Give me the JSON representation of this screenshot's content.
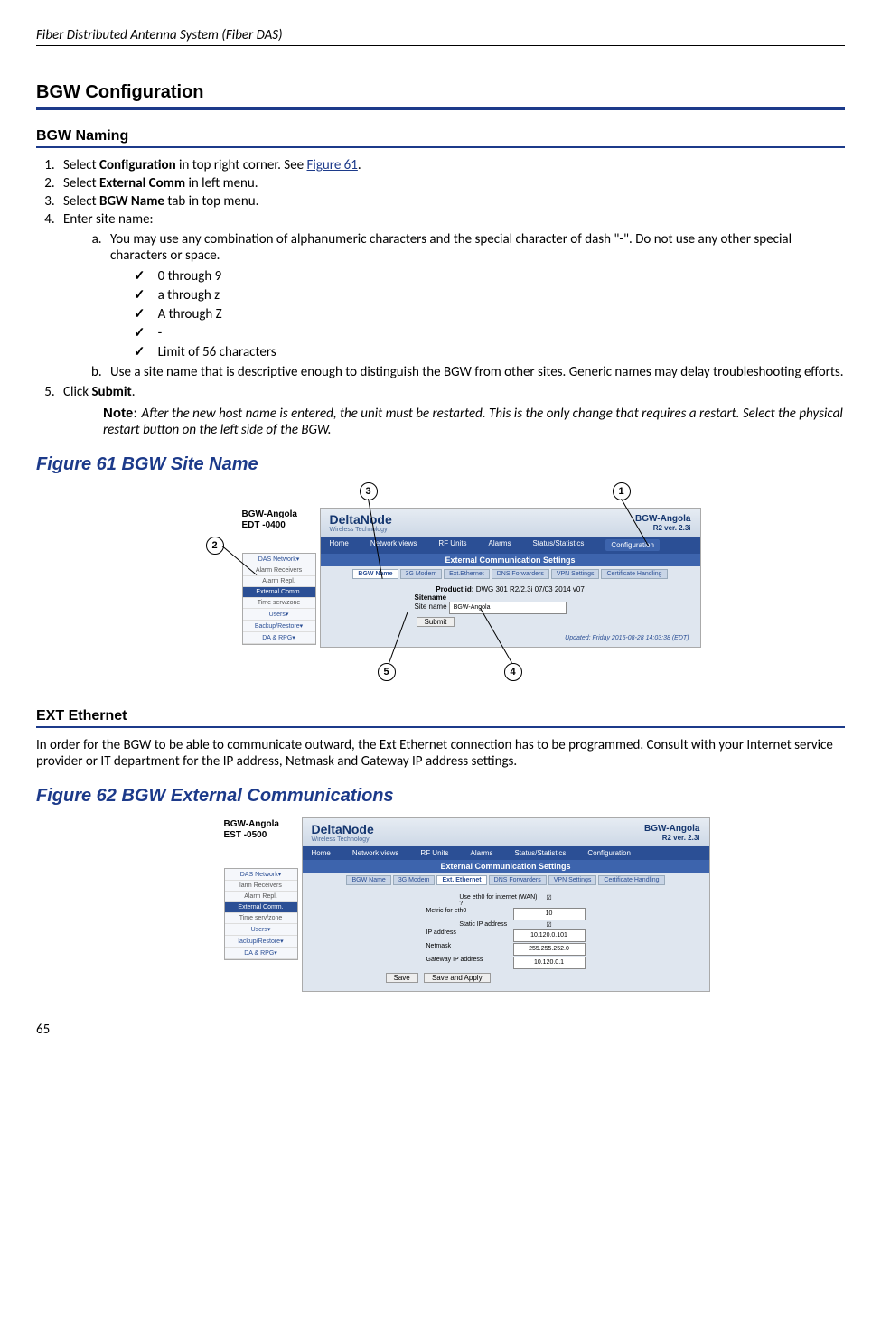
{
  "header": {
    "title": "Fiber Distributed Antenna System (Fiber DAS)"
  },
  "section": {
    "title": "BGW Configuration"
  },
  "sub1": {
    "title": "BGW Naming"
  },
  "steps": {
    "s1a": "Select ",
    "s1b": "Configuration",
    "s1c": " in top right corner. See ",
    "s1link": "Figure 61",
    "s1d": ".",
    "s2a": "Select ",
    "s2b": "External Comm",
    "s2c": " in left menu.",
    "s3a": "Select ",
    "s3b": "BGW Name",
    "s3c": " tab in top menu.",
    "s4": "Enter site name:",
    "sa": "You may use any combination of alphanumeric characters and the special character of dash \"-\".  Do not use any other special characters or space.",
    "c1": "0 through 9",
    "c2": "a through z",
    "c3": "A through Z",
    "c4": "-",
    "c5": "Limit of 56 characters",
    "sb": "Use a site name that is descriptive enough to distinguish the BGW from other sites. Generic names may delay troubleshooting efforts.",
    "s5a": "Click ",
    "s5b": "Submit",
    "s5c": "."
  },
  "note": {
    "label": "Note:  ",
    "text": "After the new host name is entered, the unit must be restarted. This is the only change that requires a restart. Select the physical restart button on the left side of the BGW."
  },
  "fig61": {
    "caption": "Figure 61    BGW Site Name",
    "timestamp_label": "BGW-Angola\nEDT -0400",
    "brand": "DeltaNode",
    "brand_sub": "Wireless Technology",
    "host": "BGW-Angola",
    "ver": "R2 ver. 2.3i",
    "nav": [
      "Home",
      "Network views",
      "RF Units",
      "Alarms",
      "Status/Statistics",
      "Configuration"
    ],
    "bluebar": "External Communication Settings",
    "tabs": [
      "BGW Name",
      "3G Modem",
      "Ext.Ethernet",
      "DNS Forwarders",
      "VPN Settings",
      "Certificate Handling"
    ],
    "product_label": "Product id:",
    "product_val": "DWG 301 R2/2.3i 07/03 2014 v07",
    "sitename_hdr": "Sitename",
    "sitename_lbl": "Site name",
    "sitename_val": "BGW-Angola",
    "submit": "Submit",
    "updated": "Updated: Friday 2015-08-28 14:03:38 (EDT)",
    "sidebar": [
      "DAS Network▾",
      "Alarm Receivers",
      "Alarm Repl.",
      "External Comm.",
      "Time serv/zone",
      "Users▾",
      "Backup/Restore▾",
      "DA & RPG▾"
    ]
  },
  "sub2": {
    "title": "EXT Ethernet"
  },
  "ext_para": "In order for the BGW to be able to communicate outward, the Ext Ethernet connection has to be programmed. Consult with your Internet service provider or IT department for the IP address, Netmask and Gateway IP address settings.",
  "fig62": {
    "caption": "Figure 62    BGW External Communications",
    "timestamp_label": "BGW-Angola\nEST -0500",
    "brand": "DeltaNode",
    "brand_sub": "Wireless Technology",
    "host": "BGW-Angola",
    "ver": "R2 ver. 2.3i",
    "nav": [
      "Home",
      "Network views",
      "RF Units",
      "Alarms",
      "Status/Statistics",
      "Configuration"
    ],
    "bluebar": "External Communication Settings",
    "tabs": [
      "BGW Name",
      "3G Modem",
      "Ext. Ethernet",
      "DNS Forwarders",
      "VPN Settings",
      "Certificate Handling"
    ],
    "rows": [
      {
        "l": "Use eth0 for internet (WAN) ?",
        "v": "☑"
      },
      {
        "l": "Metric for eth0",
        "v": "10"
      },
      {
        "l": "Static IP address",
        "v": "☑"
      },
      {
        "l": "IP address",
        "v": "10.120.0.101"
      },
      {
        "l": "Netmask",
        "v": "255.255.252.0"
      },
      {
        "l": "Gateway IP address",
        "v": "10.120.0.1"
      }
    ],
    "save": "Save",
    "save_apply": "Save and Apply",
    "sidebar": [
      "DAS Network▾",
      "larm Receivers",
      "Alarm Repl.",
      "External Comm.",
      "Time serv/zone",
      "Users▾",
      "lackup/Restore▾",
      "DA & RPG▾"
    ]
  },
  "page": "65"
}
